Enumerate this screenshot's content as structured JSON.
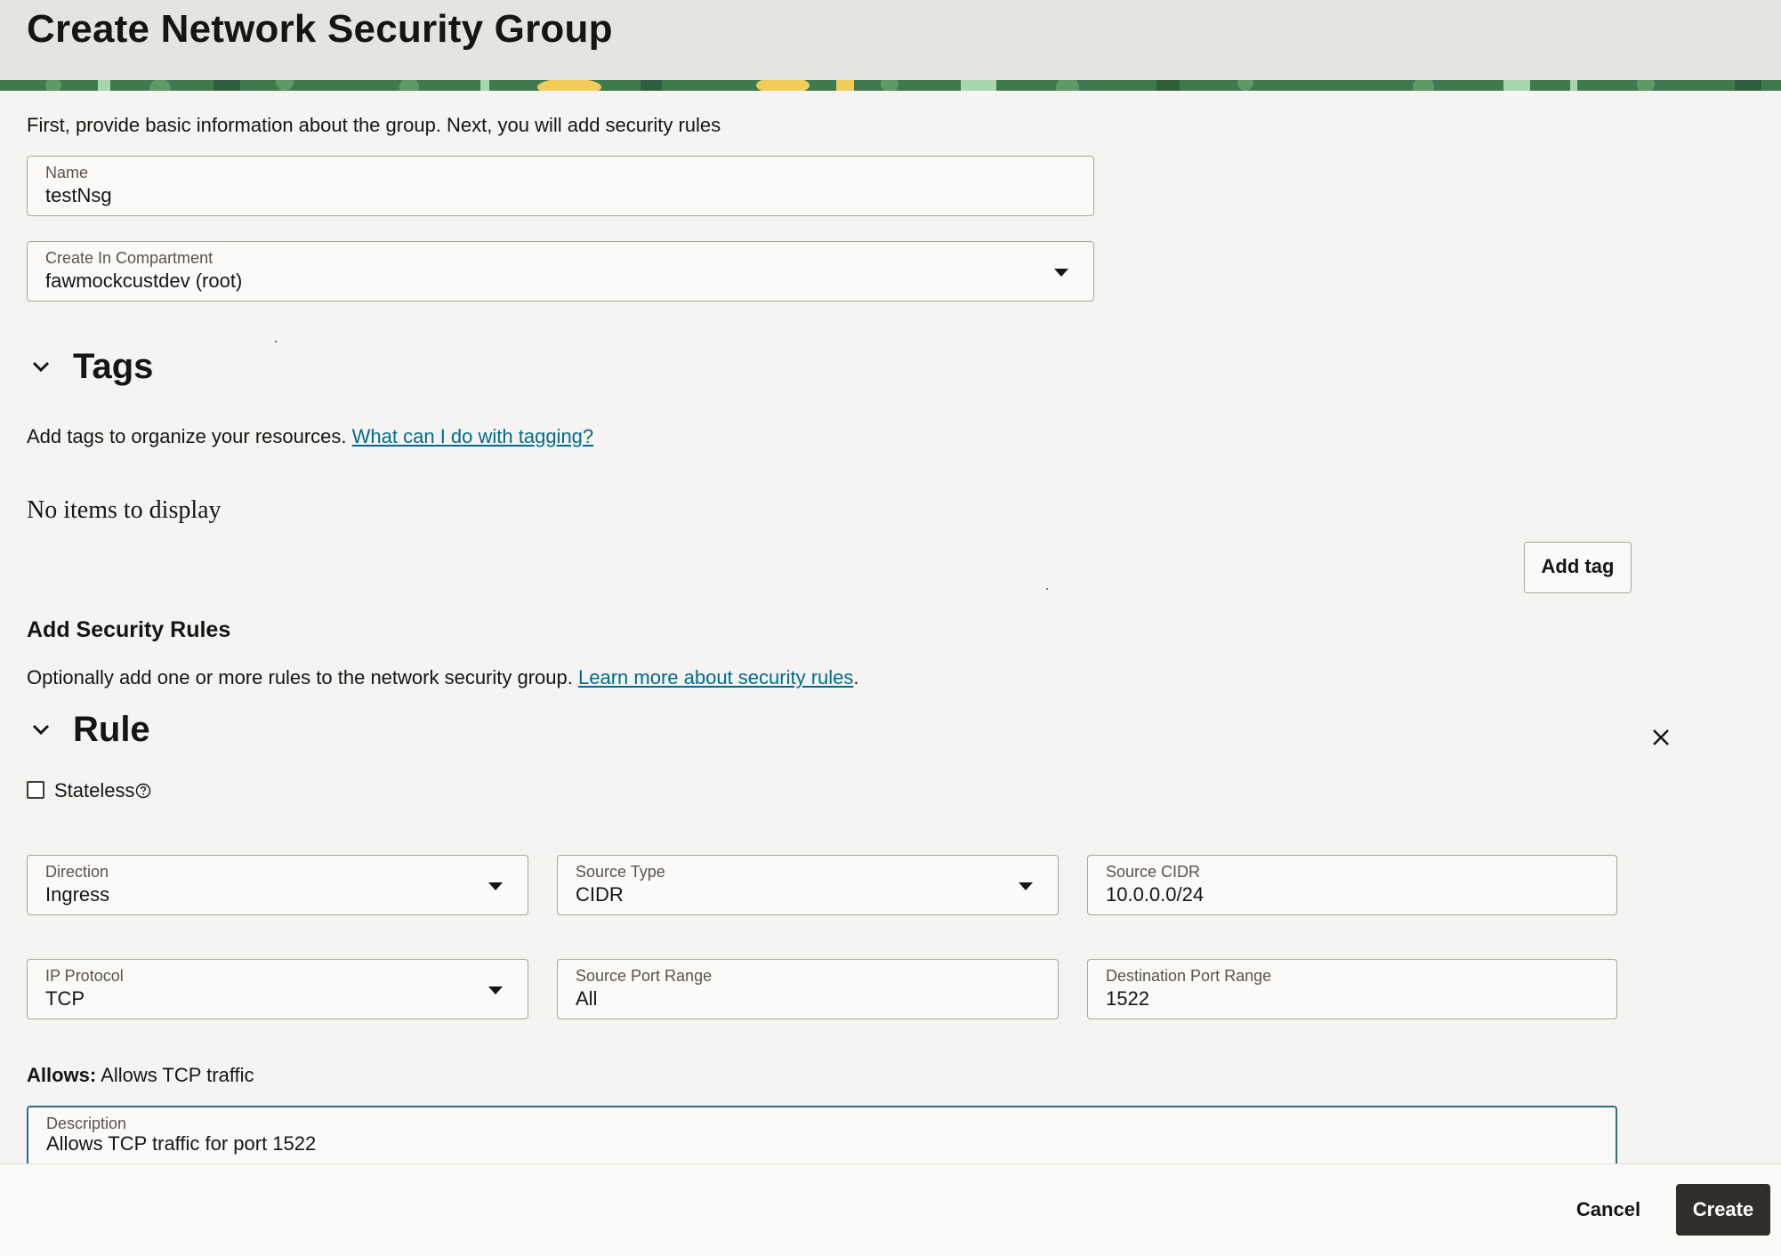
{
  "page": {
    "title": "Create Network Security Group"
  },
  "intro": {
    "text": "First, provide basic information about the group. Next, you will add security rules"
  },
  "name_field": {
    "label": "Name",
    "value": "testNsg"
  },
  "compartment_field": {
    "label": "Create In Compartment",
    "value": "fawmockcustdev (root)"
  },
  "tags": {
    "title": "Tags",
    "description": "Add tags to organize your resources.",
    "help_link": "What can I do with tagging?",
    "empty_text": "No items to display",
    "add_button": "Add tag"
  },
  "security_rules": {
    "title": "Add Security Rules",
    "description": "Optionally add one or more rules to the network security group.",
    "learn_link": "Learn more about security rules",
    "period": "."
  },
  "rule": {
    "title": "Rule",
    "stateless_label": "Stateless",
    "direction": {
      "label": "Direction",
      "value": "Ingress"
    },
    "source_type": {
      "label": "Source Type",
      "value": "CIDR"
    },
    "source_cidr": {
      "label": "Source CIDR",
      "value": "10.0.0.0/24"
    },
    "ip_protocol": {
      "label": "IP Protocol",
      "value": "TCP"
    },
    "source_port_range": {
      "label": "Source Port Range",
      "value": "All"
    },
    "destination_port_range": {
      "label": "Destination Port Range",
      "value": "1522"
    },
    "allows_label": "Allows:",
    "allows_value": "Allows TCP traffic",
    "description": {
      "label": "Description",
      "value": "Allows TCP traffic for port 1522"
    }
  },
  "footer": {
    "cancel_label": "Cancel",
    "create_label": "Create"
  },
  "colors": {
    "link": "#006b8f",
    "primary_button": "#312d2a",
    "focus_border": "#2c6d86",
    "banner": "#3f7a4e"
  }
}
